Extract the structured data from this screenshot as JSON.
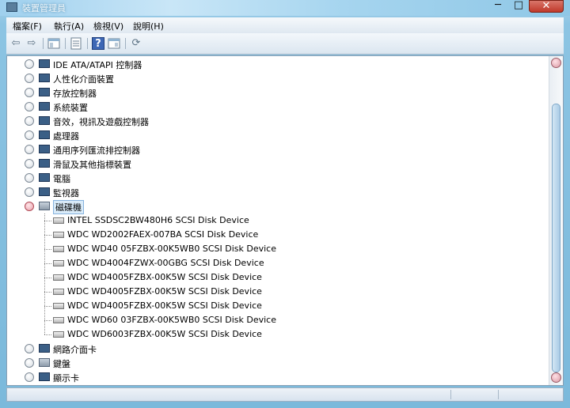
{
  "window": {
    "title": "裝置管理員",
    "minimize_glyph": "─",
    "maximize_glyph": "□",
    "close_glyph": "✕"
  },
  "menu": [
    {
      "label": "檔案(F)"
    },
    {
      "label": "執行(A)"
    },
    {
      "label": "檢視(V)"
    },
    {
      "label": "說明(H)"
    }
  ],
  "toolbar": {
    "back_icon": "back-arrow-icon",
    "forward_icon": "forward-arrow-icon",
    "properties_icon": "properties-icon",
    "show_hide_icon": "console-tree-icon",
    "help_icon": "help-icon",
    "view_icon": "view-icon",
    "scan_icon": "scan-hardware-icon",
    "back_glyph": "⇦",
    "forward_glyph": "⇨",
    "help_glyph": "?",
    "scan_glyph": "⟳"
  },
  "tree": {
    "categories_top": [
      {
        "label": "IDE ATA/ATAPI 控制器",
        "icon": "ide-controller-icon"
      },
      {
        "label": "人性化介面裝置",
        "icon": "hid-icon"
      },
      {
        "label": "存放控制器",
        "icon": "storage-controller-icon"
      },
      {
        "label": "系統裝置",
        "icon": "system-devices-icon"
      },
      {
        "label": "音效，視訊及遊戲控制器",
        "icon": "sound-icon"
      },
      {
        "label": "處理器",
        "icon": "processor-icon"
      },
      {
        "label": "通用序列匯流排控制器",
        "icon": "usb-icon"
      },
      {
        "label": "滑鼠及其他指標裝置",
        "icon": "mouse-icon"
      },
      {
        "label": "電腦",
        "icon": "computer-icon"
      },
      {
        "label": "監視器",
        "icon": "monitor-icon"
      }
    ],
    "expanded": {
      "label": "磁碟機",
      "icon": "disk-drives-icon"
    },
    "disks": [
      "INTEL SSDSC2BW480H6 SCSI Disk Device",
      "WDC WD2002FAEX-007BA SCSI Disk Device",
      "WDC WD40 05FZBX-00K5WB0 SCSI Disk Device",
      "WDC WD4004FZWX-00GBG SCSI Disk Device",
      "WDC WD4005FZBX-00K5W SCSI Disk Device",
      "WDC WD4005FZBX-00K5W SCSI Disk Device",
      "WDC WD4005FZBX-00K5W SCSI Disk Device",
      "WDC WD60 03FZBX-00K5WB0 SCSI Disk Device",
      "WDC WD6003FZBX-00K5W SCSI Disk Device"
    ],
    "categories_bottom": [
      {
        "label": "網路介面卡",
        "icon": "network-adapter-icon"
      },
      {
        "label": "鍵盤",
        "icon": "keyboard-icon"
      },
      {
        "label": "顯示卡",
        "icon": "display-adapter-icon"
      }
    ]
  },
  "colors": {
    "selection": "#d9ebf9",
    "accent": "#86b3de"
  }
}
